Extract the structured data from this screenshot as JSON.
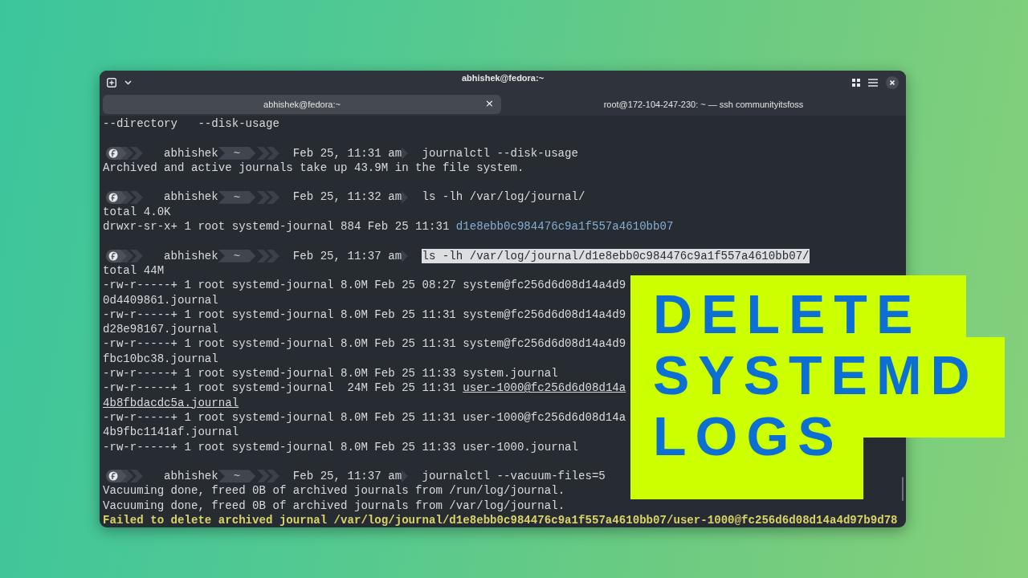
{
  "window": {
    "title": "abhishek@fedora:~"
  },
  "tabs": [
    {
      "label": "abhishek@fedora:~",
      "selected": true,
      "close": "×"
    },
    {
      "label": "root@172-104-247-230: ~ — ssh communityitsfoss",
      "selected": false
    }
  ],
  "lines": [
    {
      "kind": "output",
      "text": "--directory   --disk-usage"
    },
    {
      "kind": "blank"
    },
    {
      "kind": "prompt",
      "user": "abhishek",
      "dir": "~",
      "time": "Feb 25, 11:31 am",
      "command": "journalctl --disk-usage",
      "selected": false
    },
    {
      "kind": "output",
      "text": "Archived and active journals take up 43.9M in the file system."
    },
    {
      "kind": "blank"
    },
    {
      "kind": "prompt",
      "user": "abhishek",
      "dir": "~",
      "time": "Feb 25, 11:32 am",
      "command": "ls -lh /var/log/journal/",
      "selected": false
    },
    {
      "kind": "output",
      "text": "total 4.0K"
    },
    {
      "kind": "output",
      "text": "drwxr-sr-x+ 1 root systemd-journal 884 Feb 25 11:31 ",
      "file": {
        "name": "d1e8ebb0c984476c9a1f557a4610bb07",
        "kind": "directory"
      }
    },
    {
      "kind": "blank"
    },
    {
      "kind": "prompt",
      "user": "abhishek",
      "dir": "~",
      "time": "Feb 25, 11:37 am",
      "command": "ls -lh /var/log/journal/d1e8ebb0c984476c9a1f557a4610bb07/",
      "selected": true
    },
    {
      "kind": "output",
      "text": "total 44M"
    },
    {
      "kind": "output",
      "text": "-rw-r-----+ 1 root systemd-journal 8.0M Feb 25 08:27 system@fc256d6d08d14a4d9"
    },
    {
      "kind": "output",
      "text": "0d4409861.journal"
    },
    {
      "kind": "output",
      "text": "-rw-r-----+ 1 root systemd-journal 8.0M Feb 25 11:31 system@fc256d6d08d14a4d9"
    },
    {
      "kind": "output",
      "text": "d28e98167.journal"
    },
    {
      "kind": "output",
      "text": "-rw-r-----+ 1 root systemd-journal 8.0M Feb 25 11:31 system@fc256d6d08d14a4d9"
    },
    {
      "kind": "output",
      "text": "fbc10bc38.journal"
    },
    {
      "kind": "output",
      "text": "-rw-r-----+ 1 root systemd-journal 8.0M Feb 25 11:33 system.journal"
    },
    {
      "kind": "output",
      "text": "-rw-r-----+ 1 root systemd-journal  24M Feb 25 11:31 ",
      "file": {
        "name": "user-1000@fc256d6d08d14a",
        "kind": "hyperlink"
      }
    },
    {
      "kind": "output",
      "file": {
        "name": "4b8fbdacdc5a.journal",
        "kind": "hyperlink"
      }
    },
    {
      "kind": "output",
      "text": "-rw-r-----+ 1 root systemd-journal 8.0M Feb 25 11:31 user-1000@fc256d6d08d14a"
    },
    {
      "kind": "output",
      "text": "4b9fbc1141af.journal"
    },
    {
      "kind": "output",
      "text": "-rw-r-----+ 1 root systemd-journal 8.0M Feb 25 11:33 user-1000.journal"
    },
    {
      "kind": "blank"
    },
    {
      "kind": "prompt",
      "user": "abhishek",
      "dir": "~",
      "time": "Feb 25, 11:37 am",
      "command": "journalctl --vacuum-files=5",
      "selected": false
    },
    {
      "kind": "output",
      "text": "Vacuuming done, freed 0B of archived journals from /run/log/journal."
    },
    {
      "kind": "output",
      "text": "Vacuuming done, freed 0B of archived journals from /var/log/journal."
    },
    {
      "kind": "error",
      "text": "Failed to delete archived journal /var/log/journal/d1e8ebb0c984476c9a1f557a4610bb07/user-1000@fc256d6d08d14a4d97b9d78"
    }
  ],
  "banner": {
    "lines": [
      "DELETE",
      "SYSTEMD",
      "LOGS"
    ]
  }
}
